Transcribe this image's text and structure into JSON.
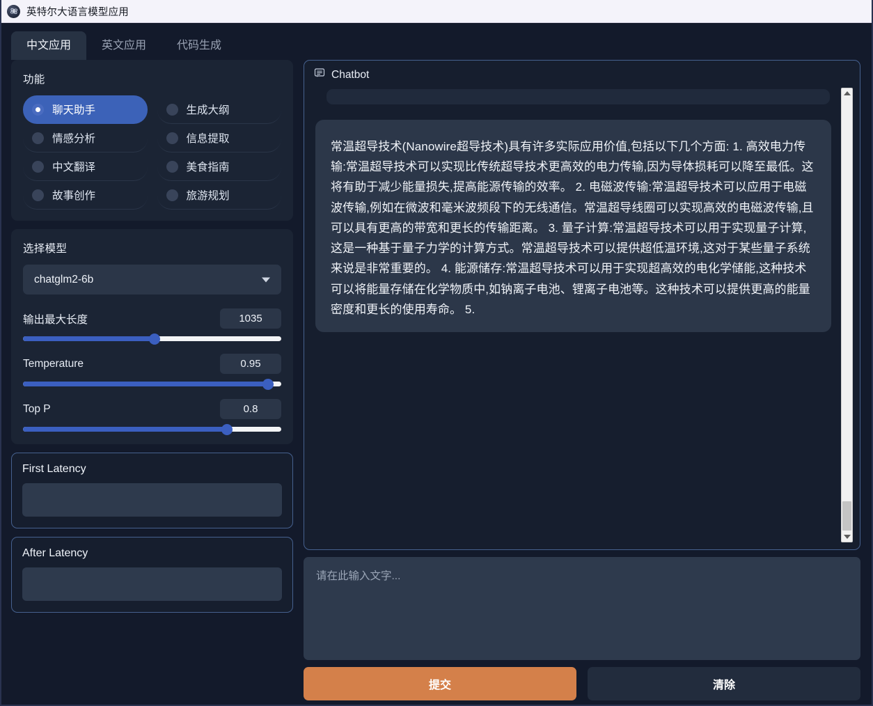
{
  "window": {
    "title": "英特尔大语言模型应用",
    "icon": "app-logo-icon"
  },
  "tabs": [
    {
      "label": "中文应用",
      "active": true
    },
    {
      "label": "英文应用",
      "active": false
    },
    {
      "label": "代码生成",
      "active": false
    }
  ],
  "functions_panel": {
    "title": "功能",
    "items": [
      {
        "label": "聊天助手",
        "selected": true
      },
      {
        "label": "生成大纲",
        "selected": false
      },
      {
        "label": "情感分析",
        "selected": false
      },
      {
        "label": "信息提取",
        "selected": false
      },
      {
        "label": "中文翻译",
        "selected": false
      },
      {
        "label": "美食指南",
        "selected": false
      },
      {
        "label": "故事创作",
        "selected": false
      },
      {
        "label": "旅游规划",
        "selected": false
      }
    ]
  },
  "model_panel": {
    "title": "选择模型",
    "select": {
      "value": "chatglm2-6b",
      "arrow_icon": "chevron-down-icon"
    },
    "sliders": [
      {
        "label": "输出最大长度",
        "value": "1035",
        "percent": 51
      },
      {
        "label": "Temperature",
        "value": "0.95",
        "percent": 95
      },
      {
        "label": "Top P",
        "value": "0.8",
        "percent": 79
      }
    ]
  },
  "latency": {
    "first": {
      "title": "First Latency",
      "value": ""
    },
    "after": {
      "title": "After Latency",
      "value": ""
    }
  },
  "chatbot": {
    "title": "Chatbot",
    "icon": "chat-bubble-icon",
    "messages": [
      {
        "role": "user",
        "text": ""
      },
      {
        "role": "assistant",
        "text": "常温超导技术(Nanowire超导技术)具有许多实际应用价值,包括以下几个方面:\n1. 高效电力传输:常温超导技术可以实现比传统超导技术更高效的电力传输,因为导体损耗可以降至最低。这将有助于减少能量损失,提高能源传输的效率。\n2. 电磁波传输:常温超导技术可以应用于电磁波传输,例如在微波和毫米波频段下的无线通信。常温超导线圈可以实现高效的电磁波传输,且可以具有更高的带宽和更长的传输距离。\n3. 量子计算:常温超导技术可以用于实现量子计算,这是一种基于量子力学的计算方式。常温超导技术可以提供超低温环境,这对于某些量子系统来说是非常重要的。\n4. 能源储存:常温超导技术可以用于实现超高效的电化学储能,这种技术可以将能量存储在化学物质中,如钠离子电池、锂离子电池等。这种技术可以提供更高的能量密度和更长的使用寿命。\n5."
      }
    ],
    "scrollbar": {
      "up_arrow_icon": "scroll-up-arrow-icon",
      "down_arrow_icon": "scroll-down-arrow-icon"
    }
  },
  "prompt": {
    "placeholder": "请在此输入文字...",
    "value": ""
  },
  "actions": {
    "submit_label": "提交",
    "clear_label": "清除"
  },
  "colors": {
    "accent_blue": "#3c62b8",
    "slider_blue": "#3b5fc0",
    "submit_orange": "#d4804a",
    "panel_bg": "#1b2434",
    "app_bg": "#131a2b",
    "border_blue": "#46618f"
  }
}
